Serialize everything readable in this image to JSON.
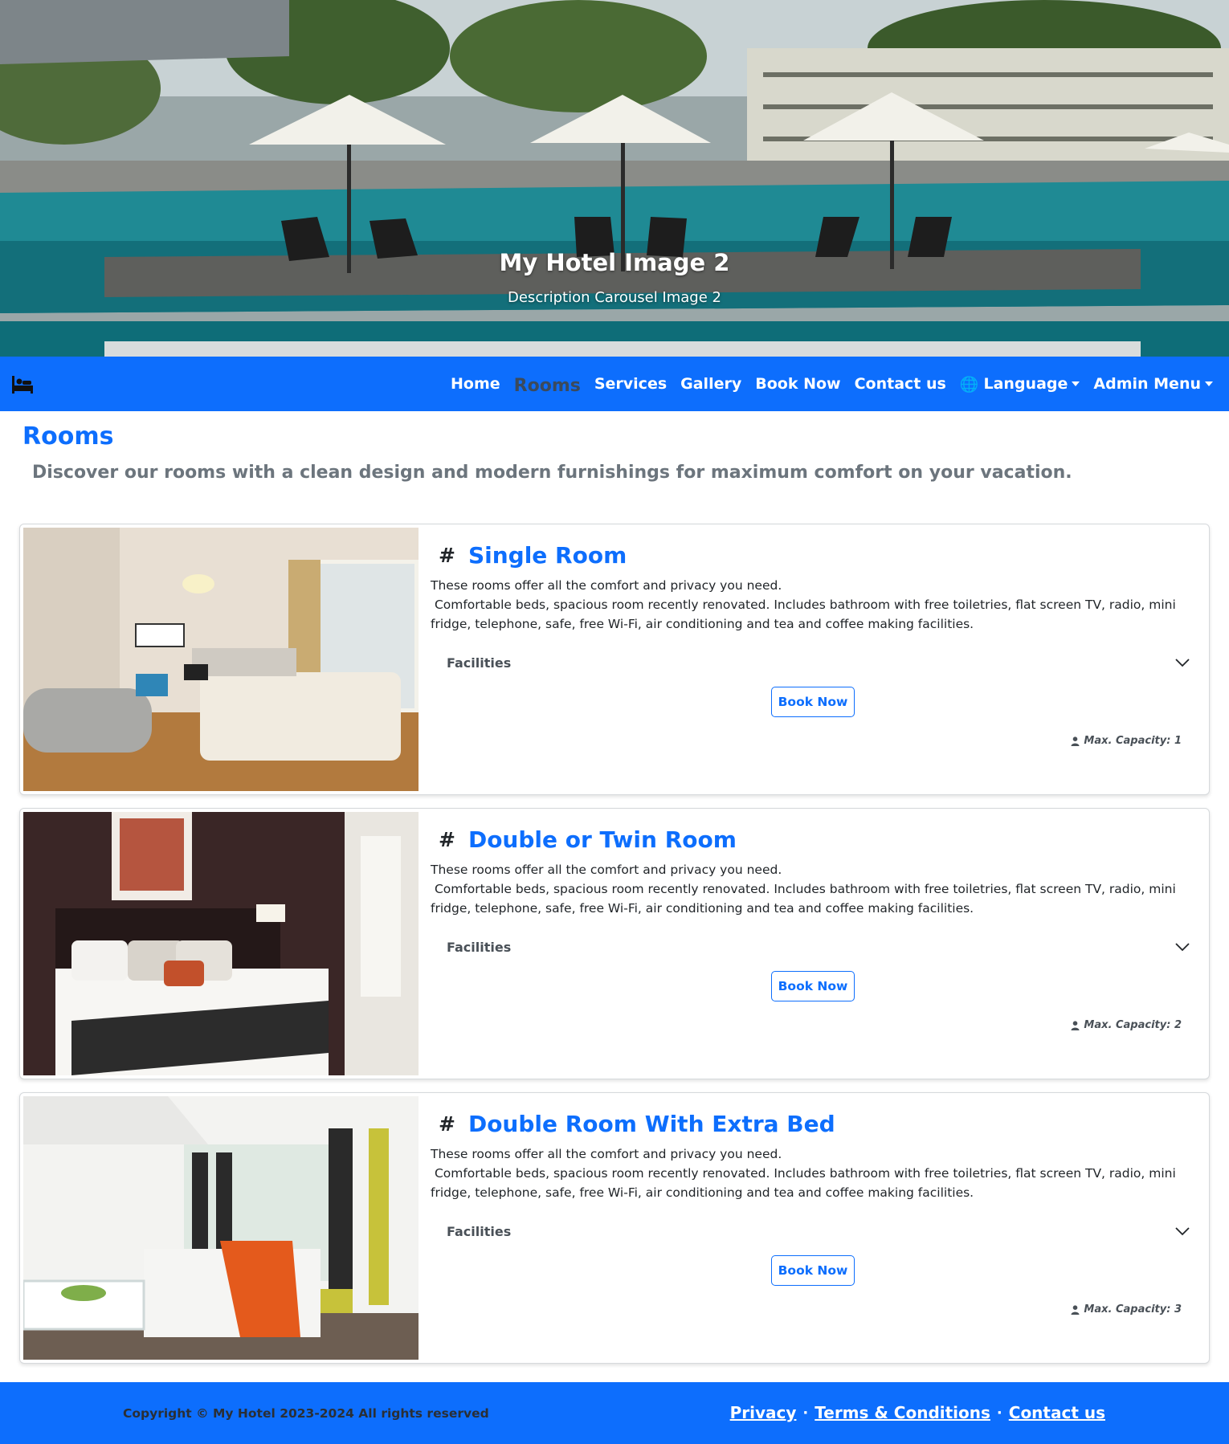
{
  "hero": {
    "title": "My Hotel Image 2",
    "description": "Description Carousel Image 2"
  },
  "navbar": {
    "brand_icon": "hotel-bed-icon",
    "items": [
      {
        "label": "Home"
      },
      {
        "label": "Rooms",
        "active": true
      },
      {
        "label": "Services"
      },
      {
        "label": "Gallery"
      },
      {
        "label": "Book Now"
      },
      {
        "label": "Contact us"
      },
      {
        "label": "Language",
        "icon": "globe-icon",
        "dropdown": true
      },
      {
        "label": "Admin Menu",
        "dropdown": true
      }
    ]
  },
  "page": {
    "title": "Rooms",
    "subtitle": "Discover our rooms with a clean design and modern furnishings for maximum comfort on your vacation."
  },
  "rooms": [
    {
      "hash": "#",
      "name": "Single Room",
      "intro": "These rooms offer all the comfort and privacy you need.",
      "details": " Comfortable beds, spacious room recently renovated. Includes bathroom with free toiletries, flat screen TV, radio, mini fridge, telephone, safe, free Wi-Fi, air conditioning and tea and coffee making facilities.",
      "facilities_label": "Facilities",
      "book_label": "Book Now",
      "capacity": "Max. Capacity: 1"
    },
    {
      "hash": "#",
      "name": "Double or Twin Room",
      "intro": "These rooms offer all the comfort and privacy you need.",
      "details": " Comfortable beds, spacious room recently renovated. Includes bathroom with free toiletries, flat screen TV, radio, mini fridge, telephone, safe, free Wi-Fi, air conditioning and tea and coffee making facilities.",
      "facilities_label": "Facilities",
      "book_label": "Book Now",
      "capacity": "Max. Capacity: 2"
    },
    {
      "hash": "#",
      "name": "Double Room With Extra Bed",
      "intro": "These rooms offer all the comfort and privacy you need.",
      "details": " Comfortable beds, spacious room recently renovated. Includes bathroom with free toiletries, flat screen TV, radio, mini fridge, telephone, safe, free Wi-Fi, air conditioning and tea and coffee making facilities.",
      "facilities_label": "Facilities",
      "book_label": "Book Now",
      "capacity": "Max. Capacity: 3"
    }
  ],
  "footer": {
    "copyright": "Copyright © My Hotel 2023-2024 All rights reserved",
    "links": [
      {
        "label": "Privacy"
      },
      {
        "label": "Terms & Conditions"
      },
      {
        "label": "Contact us"
      }
    ],
    "separator": "·"
  },
  "colors": {
    "primary": "#0d6efd",
    "muted": "#6c757d",
    "active_nav": "#3b4a5c"
  }
}
